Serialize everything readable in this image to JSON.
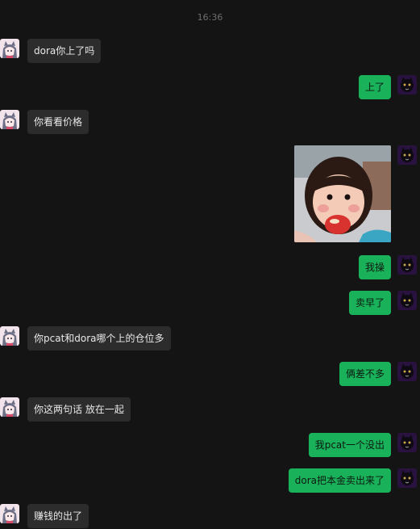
{
  "time": "16:36",
  "colors": {
    "background": "#141414",
    "incoming_bubble": "#2c2c2c",
    "outgoing_bubble": "#19b25a"
  },
  "avatars": {
    "left": "anime-character-avatar",
    "right": "dark-cat-avatar"
  },
  "messages": [
    {
      "side": "left",
      "text": "dora你上了吗"
    },
    {
      "side": "right",
      "text": "上了"
    },
    {
      "side": "left",
      "text": "你看看价格"
    },
    {
      "side": "right",
      "type": "image",
      "image_desc": "sticker-child-eating-apple"
    },
    {
      "side": "right",
      "text": "我操"
    },
    {
      "side": "right",
      "text": "卖早了"
    },
    {
      "side": "left",
      "text": "你pcat和dora哪个上的仓位多"
    },
    {
      "side": "right",
      "text": "俩差不多"
    },
    {
      "side": "left",
      "text": "你这两句话 放在一起"
    },
    {
      "side": "right",
      "text": "我pcat一个没出"
    },
    {
      "side": "right",
      "text": "dora把本金卖出来了"
    },
    {
      "side": "left",
      "text": "赚钱的出了"
    }
  ]
}
